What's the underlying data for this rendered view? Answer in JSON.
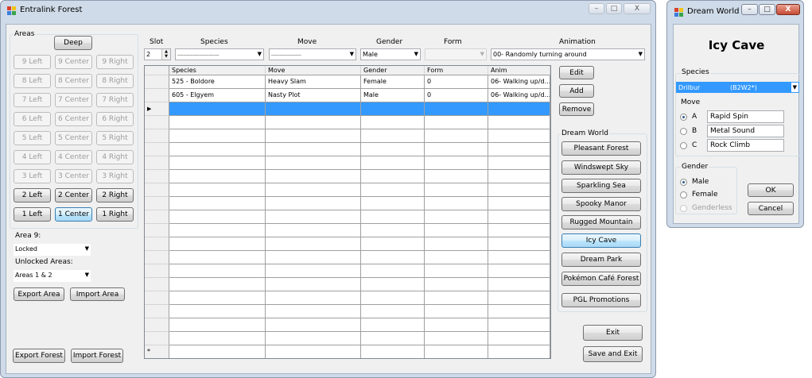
{
  "main_window": {
    "title": "Entralink Forest",
    "controls": {
      "minimize": "–",
      "maximize": "□",
      "close": "X"
    },
    "areas": {
      "label": "Areas",
      "deep": "Deep",
      "grid": [
        [
          "9 Left",
          "9 Center",
          "9 Right"
        ],
        [
          "8 Left",
          "8 Center",
          "8 Right"
        ],
        [
          "7 Left",
          "7 Center",
          "7 Right"
        ],
        [
          "6 Left",
          "6 Center",
          "6 Right"
        ],
        [
          "5 Left",
          "5 Center",
          "5 Right"
        ],
        [
          "4 Left",
          "4 Center",
          "4 Right"
        ],
        [
          "3 Left",
          "3 Center",
          "3 Right"
        ],
        [
          "2 Left",
          "2 Center",
          "2 Right"
        ],
        [
          "1 Left",
          "1 Center",
          "1 Right"
        ]
      ],
      "area9_label": "Area 9:",
      "area9_value": "Locked",
      "unlocked_label": "Unlocked Areas:",
      "unlocked_value": "Areas 1 & 2",
      "export_area": "Export Area",
      "import_area": "Import Area"
    },
    "export_forest": "Export Forest",
    "import_forest": "Import Forest",
    "editor": {
      "slot_label": "Slot",
      "slot_value": "2",
      "species_label": "Species",
      "species_value": "-----------------------------",
      "move_label": "Move",
      "move_value": "---------------------",
      "gender_label": "Gender",
      "gender_value": "Male",
      "form_label": "Form",
      "form_value": "",
      "animation_label": "Animation",
      "animation_value": "00- Randomly turning around"
    },
    "table": {
      "columns": [
        "Species",
        "Move",
        "Gender",
        "Form",
        "Anim"
      ],
      "rows": [
        [
          "525 - Boldore",
          "Heavy Slam",
          "Female",
          "0",
          "06- Walking up/d..."
        ],
        [
          "605 - Elgyem",
          "Nasty Plot",
          "Male",
          "0",
          "06- Walking up/d..."
        ]
      ],
      "current_row_marker": "▶",
      "new_row_marker": "*"
    },
    "buttons": {
      "edit": "Edit",
      "add": "Add",
      "remove": "Remove",
      "exit": "Exit",
      "save_exit": "Save and Exit"
    },
    "dream_world": {
      "label": "Dream World",
      "items": [
        "Pleasant Forest",
        "Windswept Sky",
        "Sparkling Sea",
        "Spooky Manor",
        "Rugged Mountain",
        "Icy Cave",
        "Dream Park",
        "Pokémon Café Forest",
        "PGL Promotions"
      ],
      "selected": "Icy Cave"
    }
  },
  "dialog": {
    "title": "Dream World",
    "heading": "Icy Cave",
    "species_label": "Species",
    "species_name": "Drilbur",
    "species_tag": "(B2W2*)",
    "move_label": "Move",
    "moves": [
      {
        "key": "A",
        "value": "Rapid Spin"
      },
      {
        "key": "B",
        "value": "Metal Sound"
      },
      {
        "key": "C",
        "value": "Rock Climb"
      }
    ],
    "gender_label": "Gender",
    "genders": [
      "Male",
      "Female",
      "Genderless"
    ],
    "ok": "OK",
    "cancel": "Cancel"
  },
  "colors": {
    "selection": "#3399ff",
    "title_bg": "#cfdbe9",
    "client_bg": "#f0f0f0",
    "close_red": "#c74a32"
  }
}
